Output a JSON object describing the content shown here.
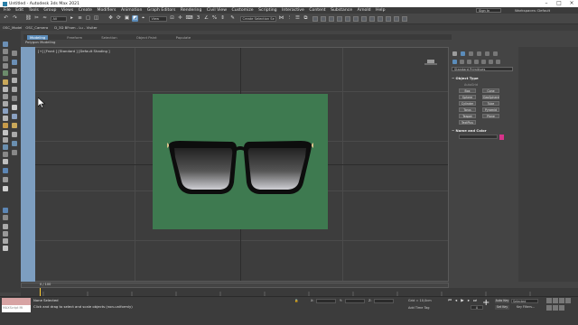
{
  "title_bar": {
    "title": "Untitled - Autodesk 3ds Max 2021"
  },
  "menu": {
    "items": [
      "File",
      "Edit",
      "Tools",
      "Group",
      "Views",
      "Create",
      "Modifiers",
      "Animation",
      "Graph Editors",
      "Rendering",
      "Civil View",
      "Customize",
      "Scripting",
      "Interactive",
      "Content",
      "Substance",
      "Arnold",
      "Help"
    ],
    "sign_in": "Sign In",
    "workspaces": "Workspaces:  Default"
  },
  "toolbar": {
    "filter_dropdown": "All",
    "view_dropdown": "View",
    "create_selection_set": "Create Selection Se",
    "percent_value": "3",
    "layer_dropdown": "0 (default)"
  },
  "doc_tabs": [
    "OSC_Model",
    "OSC_Camera",
    "D_3D BFrom - Lu - Visiter"
  ],
  "ribbon_tabs": [
    "Modeling",
    "Freeform",
    "Selection",
    "Object Paint",
    "Populate"
  ],
  "ribbon_sub": "Polygon Modeling",
  "viewport": {
    "label": "[+] [Front ] [Standard ] [Default Shading ]"
  },
  "command_panel": {
    "category": "Standard Primitives",
    "object_type_title": "Object Type",
    "autogrid": "AutoGrid",
    "object_buttons": [
      "Box",
      "Cone",
      "Sphere",
      "GeoSphere",
      "Cylinder",
      "Tube",
      "Torus",
      "Pyramid",
      "Teapot",
      "Plane",
      "TextPlus"
    ],
    "name_color_title": "Name and Color",
    "swatch_color": "#d6338a"
  },
  "timeline": {
    "frame_label": "0 / 100"
  },
  "status": {
    "maxscript_label": "MAXScript Mi",
    "none_selected": "None Selected",
    "hint": "Click and drag to select and scale objects (non-uniformly)",
    "x_label": "X:",
    "y_label": "Y:",
    "z_label": "Z:",
    "grid": "Grid = 10,0cm",
    "add_time_tag": "Add Time Tag",
    "auto_key": "Auto Key",
    "set_key": "Set Key",
    "selected": "Selected",
    "key_filters": "Key Filters...",
    "current_frame": "0"
  },
  "colors": {
    "accent": "#5b8cba",
    "viewport_green": "#3e7a50",
    "viewport_bg": "#3d3d3d"
  }
}
